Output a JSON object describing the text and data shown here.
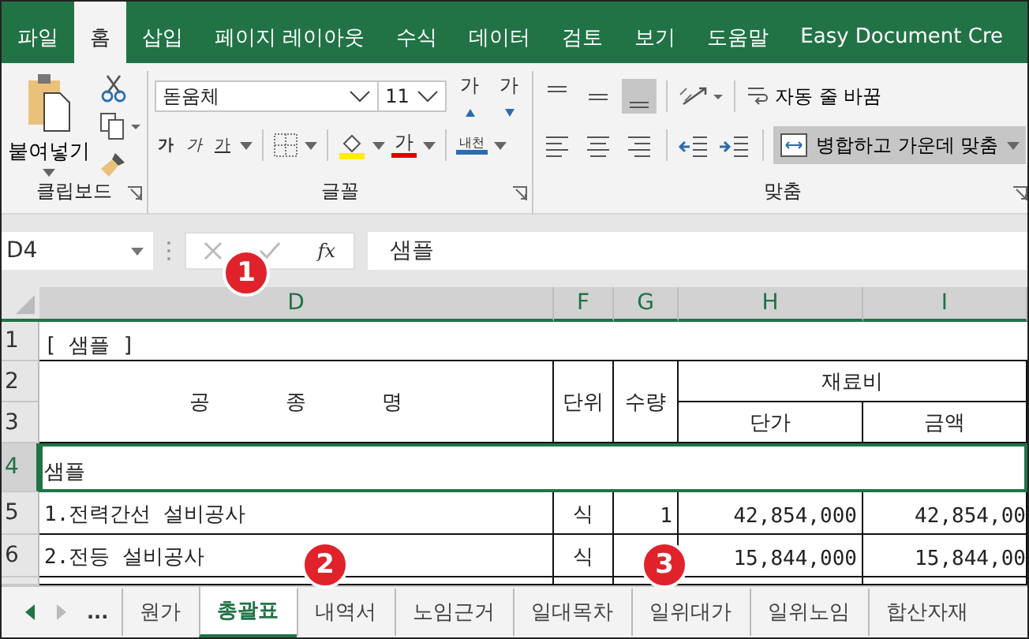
{
  "ribbon_tabs": [
    {
      "label": "파일",
      "selected": false
    },
    {
      "label": "홈",
      "selected": true
    },
    {
      "label": "삽입",
      "selected": false
    },
    {
      "label": "페이지 레이아웃",
      "selected": false
    },
    {
      "label": "수식",
      "selected": false
    },
    {
      "label": "데이터",
      "selected": false
    },
    {
      "label": "검토",
      "selected": false
    },
    {
      "label": "보기",
      "selected": false
    },
    {
      "label": "도움말",
      "selected": false
    },
    {
      "label": "Easy Document Cre",
      "selected": false
    }
  ],
  "ribbon": {
    "clipboard": {
      "paste_label": "붙여넣기",
      "group_label": "클립보드"
    },
    "font": {
      "font_name": "돋움체",
      "font_size": "11",
      "grow": "가",
      "shrink": "가",
      "bold": "가",
      "italic": "가",
      "underline": "가",
      "font_color_glyph": "가",
      "phonetic": "내천",
      "group_label": "글꼴"
    },
    "alignment": {
      "wrap_text": "자동 줄 바꿈",
      "merge_center": {
        "label": "병합하고 가운데 맞춤",
        "selected": true
      },
      "bottom_align_selected": true,
      "group_label": "맞춤"
    }
  },
  "formula_bar": {
    "name_box": "D4",
    "fx": "fx",
    "value": "샘플"
  },
  "columns": [
    {
      "label": "D",
      "selected": true
    },
    {
      "label": "F",
      "selected": true
    },
    {
      "label": "G",
      "selected": true
    },
    {
      "label": "H",
      "selected": true
    },
    {
      "label": "I",
      "selected": true
    }
  ],
  "row_headers": [
    {
      "label": "1",
      "selected": false
    },
    {
      "label": "2",
      "selected": false
    },
    {
      "label": "3",
      "selected": false
    },
    {
      "label": "4",
      "selected": true
    },
    {
      "label": "5",
      "selected": false
    },
    {
      "label": "6",
      "selected": false
    }
  ],
  "sheet": {
    "title": "[ 샘플 ]",
    "header": {
      "item": "공 종 명",
      "unit": "단위",
      "qty": "수량",
      "material": "재료비",
      "unit_price": "단가",
      "amount": "금액"
    },
    "active_cell": "샘플",
    "items": [
      {
        "name": "1.전력간선 설비공사",
        "unit": "식",
        "qty": "1",
        "unit_price": "42,854,000",
        "amount": "42,854,00"
      },
      {
        "name": "2.전등 설비공사",
        "unit": "식",
        "unit_price": "15,844,000",
        "amount": "15,844,00"
      }
    ]
  },
  "sheet_tabs": {
    "more": "...",
    "tabs": [
      {
        "label": "원가",
        "selected": false
      },
      {
        "label": "총괄표",
        "selected": true
      },
      {
        "label": "내역서",
        "selected": false
      },
      {
        "label": "노임근거",
        "selected": false
      },
      {
        "label": "일대목차",
        "selected": false
      },
      {
        "label": "일위대가",
        "selected": false
      },
      {
        "label": "일위노임",
        "selected": false
      },
      {
        "label": "합산자재",
        "selected": false
      }
    ]
  },
  "callouts": [
    "1",
    "2",
    "3"
  ]
}
